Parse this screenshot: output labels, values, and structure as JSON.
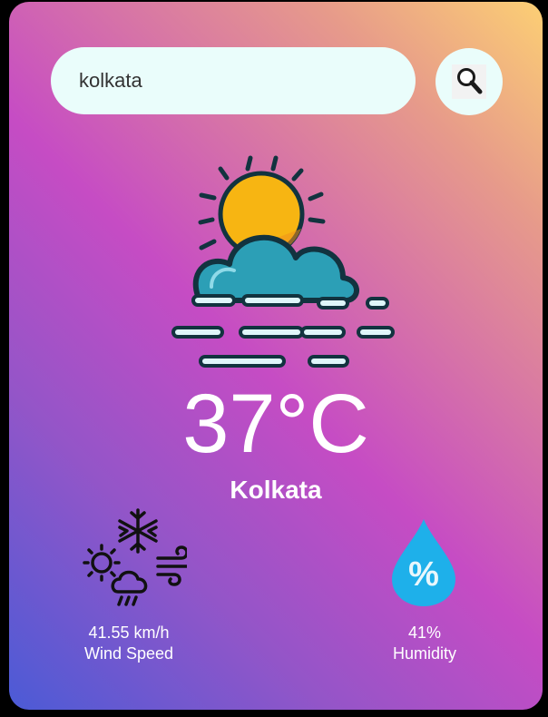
{
  "search": {
    "value": "kolkata",
    "button_icon": "magnifier-icon"
  },
  "weather": {
    "condition_icon": "sun-cloud-mist-icon",
    "temperature": "37°C",
    "city": "Kolkata"
  },
  "details": {
    "wind": {
      "icon": "mixed-weather-wind-icon",
      "value": "41.55 km/h",
      "label": "Wind Speed"
    },
    "humidity": {
      "icon": "humidity-drop-icon",
      "value": "41%",
      "label": "Humidity"
    }
  },
  "colors": {
    "card_gradient": [
      "#fccf74",
      "#e79b8a",
      "#c64cc4",
      "#9455c8",
      "#4b5bd6"
    ],
    "search_background": "#eafdfb",
    "cloud": "#2c9fb6",
    "sun": "#f7b512",
    "drop": "#1eb0ea",
    "outline": "#12333f"
  }
}
